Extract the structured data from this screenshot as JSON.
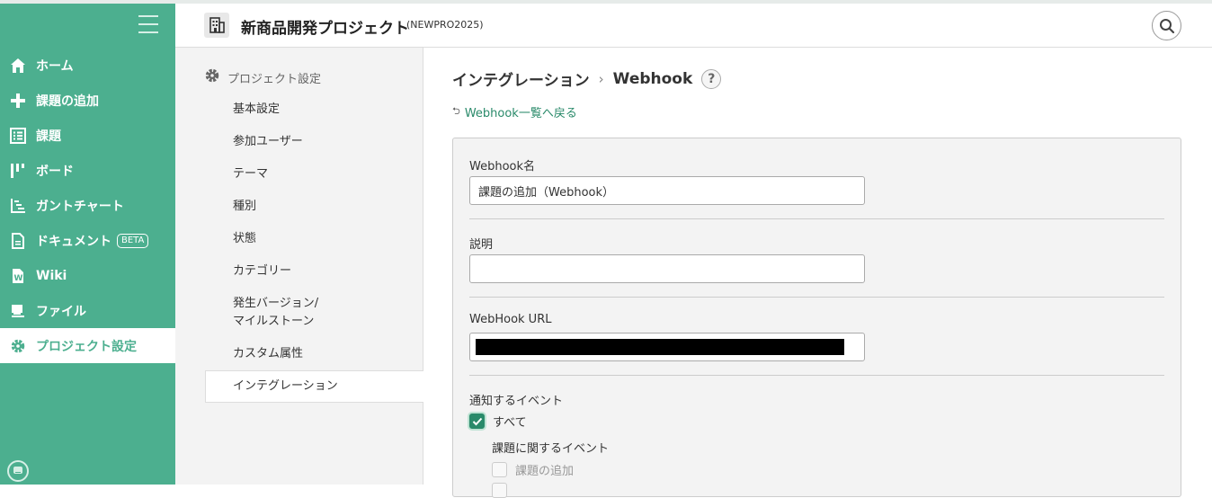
{
  "sidebar": {
    "items": [
      {
        "label": "ホーム",
        "icon": "home-icon"
      },
      {
        "label": "課題の追加",
        "icon": "plus-icon"
      },
      {
        "label": "課題",
        "icon": "list-icon"
      },
      {
        "label": "ボード",
        "icon": "board-icon"
      },
      {
        "label": "ガントチャート",
        "icon": "gantt-icon"
      },
      {
        "label": "ドキュメント",
        "icon": "document-icon",
        "badge": "BETA"
      },
      {
        "label": "Wiki",
        "icon": "wiki-icon"
      },
      {
        "label": "ファイル",
        "icon": "file-icon"
      },
      {
        "label": "プロジェクト設定",
        "icon": "gear-icon",
        "active": true
      }
    ]
  },
  "header": {
    "project_name": "新商品開発プロジェクト",
    "project_key": "(NEWPRO2025)"
  },
  "settings_menu": {
    "title": "プロジェクト設定",
    "items": [
      "基本設定",
      "参加ユーザー",
      "テーマ",
      "種別",
      "状態",
      "カテゴリー",
      "発生バージョン/\nマイルストーン",
      "カスタム属性",
      "インテグレーション"
    ],
    "active_index": 8
  },
  "main": {
    "breadcrumb_parent": "インテグレーション",
    "breadcrumb_current": "Webhook",
    "help": "?",
    "back_link": "Webhook一覧へ戻る",
    "form": {
      "name_label": "Webhook名",
      "name_value": "課題の追加（Webhook）",
      "description_label": "説明",
      "description_value": "",
      "url_label": "WebHook URL",
      "events_label": "通知するイベント",
      "all_label": "すべて",
      "issue_events_label": "課題に関するイベント",
      "add_issue_label": "課題の追加"
    }
  },
  "colors": {
    "brand": "#4caf8f",
    "link": "#2a8a6a"
  }
}
